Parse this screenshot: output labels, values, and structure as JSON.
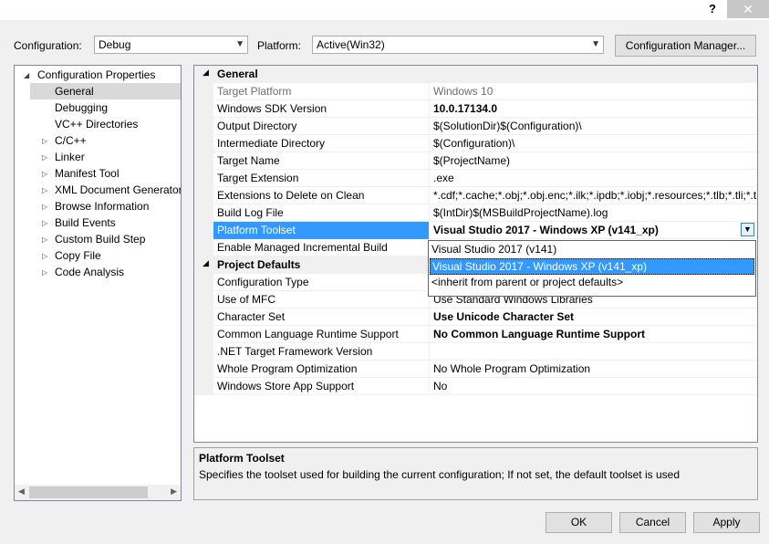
{
  "titlebar": {
    "help_label": "?",
    "close_label": "✕"
  },
  "toolbar": {
    "configuration_label": "Configuration:",
    "configuration_value": "Debug",
    "platform_label": "Platform:",
    "platform_value": "Active(Win32)",
    "config_manager_label": "Configuration Manager..."
  },
  "tree": {
    "root": "Configuration Properties",
    "items": [
      {
        "label": "General",
        "selected": true
      },
      {
        "label": "Debugging"
      },
      {
        "label": "VC++ Directories"
      },
      {
        "label": "C/C++"
      },
      {
        "label": "Linker"
      },
      {
        "label": "Manifest Tool"
      },
      {
        "label": "XML Document Generator"
      },
      {
        "label": "Browse Information"
      },
      {
        "label": "Build Events"
      },
      {
        "label": "Custom Build Step"
      },
      {
        "label": "Copy File"
      },
      {
        "label": "Code Analysis"
      }
    ]
  },
  "grid": {
    "general_header": "General",
    "rows": [
      {
        "name": "Target Platform",
        "value": "Windows 10"
      },
      {
        "name": "Windows SDK Version",
        "value": "10.0.17134.0"
      },
      {
        "name": "Output Directory",
        "value": "$(SolutionDir)$(Configuration)\\"
      },
      {
        "name": "Intermediate Directory",
        "value": "$(Configuration)\\"
      },
      {
        "name": "Target Name",
        "value": "$(ProjectName)"
      },
      {
        "name": "Target Extension",
        "value": ".exe"
      },
      {
        "name": "Extensions to Delete on Clean",
        "value": "*.cdf;*.cache;*.obj;*.obj.enc;*.ilk;*.ipdb;*.iobj;*.resources;*.tlb;*.tli;*.t"
      },
      {
        "name": "Build Log File",
        "value": "$(IntDir)$(MSBuildProjectName).log"
      },
      {
        "name": "Platform Toolset",
        "value": "Visual Studio 2017 - Windows XP (v141_xp)"
      },
      {
        "name": "Enable Managed Incremental Build",
        "value": ""
      }
    ],
    "defaults_header": "Project Defaults",
    "defaults_rows": [
      {
        "name": "Configuration Type",
        "value": ""
      },
      {
        "name": "Use of MFC",
        "value": "Use Standard Windows Libraries"
      },
      {
        "name": "Character Set",
        "value": "Use Unicode Character Set"
      },
      {
        "name": "Common Language Runtime Support",
        "value": "No Common Language Runtime Support"
      },
      {
        "name": ".NET Target Framework Version",
        "value": ""
      },
      {
        "name": "Whole Program Optimization",
        "value": "No Whole Program Optimization"
      },
      {
        "name": "Windows Store App Support",
        "value": "No"
      }
    ]
  },
  "dropdown": {
    "options": [
      "Visual Studio 2017 (v141)",
      "Visual Studio 2017 - Windows XP (v141_xp)",
      "<inherit from parent or project defaults>"
    ]
  },
  "description": {
    "title": "Platform Toolset",
    "text": "Specifies the toolset used for building the current configuration; If not set, the default toolset is used"
  },
  "buttons": {
    "ok": "OK",
    "cancel": "Cancel",
    "apply": "Apply"
  },
  "colors": {
    "selection": "#3399ff",
    "accent": "#0078d7"
  }
}
